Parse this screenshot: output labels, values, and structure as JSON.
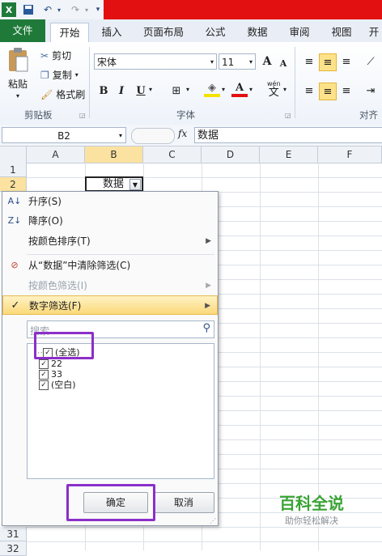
{
  "title_bar": {
    "app_icon": "excel-icon",
    "save_icon": "save-icon",
    "undo_icon": "undo-icon",
    "redo_icon": "redo-icon",
    "customize_icon": "customize-arrow-icon"
  },
  "tabs": [
    {
      "label": "文件"
    },
    {
      "label": "开始"
    },
    {
      "label": "插入"
    },
    {
      "label": "页面布局"
    },
    {
      "label": "公式"
    },
    {
      "label": "数据"
    },
    {
      "label": "审阅"
    },
    {
      "label": "视图"
    },
    {
      "label": "开"
    }
  ],
  "ribbon": {
    "clipboard": {
      "paste": "粘贴",
      "cut": "剪切",
      "copy": "复制",
      "format_painter": "格式刷",
      "group": "剪贴板"
    },
    "font": {
      "name": "宋体",
      "size": "11",
      "bold": "B",
      "italic": "I",
      "underline": "U",
      "grow": "A",
      "shrink": "A",
      "group": "字体",
      "wen": "wén",
      "wen_char": "文"
    },
    "alignment": {
      "group": "对齐"
    }
  },
  "formula_bar": {
    "name_box": "B2",
    "fx": "fx",
    "content": "数据"
  },
  "columns": [
    "A",
    "B",
    "C",
    "D",
    "E",
    "F"
  ],
  "rows": [
    "1",
    "2",
    "31",
    "32"
  ],
  "cell_b2": "数据",
  "filter_menu": {
    "sort_asc": "升序(S)",
    "sort_desc": "降序(O)",
    "sort_color": "按颜色排序(T)",
    "clear_filter": "从“数据”中清除筛选(C)",
    "filter_color": "按颜色筛选(I)",
    "number_filter": "数字筛选(F)",
    "search_placeholder": "搜索",
    "items": [
      "(全选)",
      "22",
      "33",
      "(空白)"
    ],
    "ok": "确定",
    "cancel": "取消"
  },
  "watermark": {
    "title": "百科全说",
    "subtitle": "助你轻松解决"
  },
  "colors": {
    "accent_green": "#1f7a3a",
    "highlight": "#fbd97a",
    "annotation": "#8b2fc9",
    "banner": "#e21010"
  }
}
